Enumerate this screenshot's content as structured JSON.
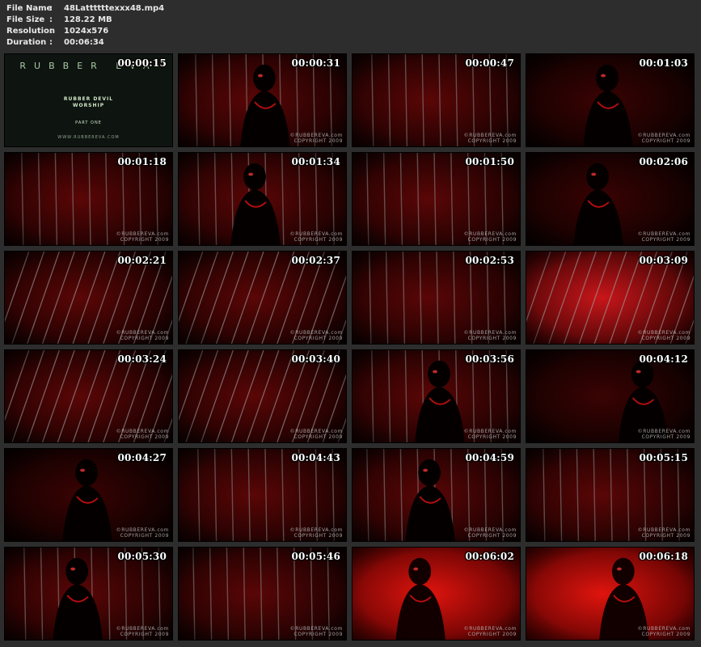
{
  "file_info": {
    "rows": [
      {
        "label": "File Name",
        "value": "48Lattttttexxx48.mp4"
      },
      {
        "label": "File Size",
        "value": "128.22 MB"
      },
      {
        "label": "Resolution",
        "value": "1024x576"
      },
      {
        "label": "Duration",
        "value": "00:06:34"
      }
    ],
    "separator": ":"
  },
  "title_card": {
    "brand": "RUBBER EVA",
    "subtitle_line1": "RUBBER DEVIL",
    "subtitle_line2": "WORSHIP",
    "part": "PART ONE",
    "url": "WWW.RUBBEREVA.COM"
  },
  "watermark": {
    "line1": "©RUBBEREVA.com",
    "line2": "COPYRIGHT 2009"
  },
  "thumbnails": [
    {
      "time": "00:00:15",
      "scene": "title",
      "watermark": false
    },
    {
      "time": "00:00:31",
      "scene": "figure-bars",
      "watermark": true
    },
    {
      "time": "00:00:47",
      "scene": "red-bars",
      "watermark": true
    },
    {
      "time": "00:01:03",
      "scene": "dark-figure",
      "watermark": true
    },
    {
      "time": "00:01:18",
      "scene": "red-bars",
      "watermark": true
    },
    {
      "time": "00:01:34",
      "scene": "figure-bars",
      "watermark": true
    },
    {
      "time": "00:01:50",
      "scene": "red-bars",
      "watermark": true
    },
    {
      "time": "00:02:06",
      "scene": "dark-figure",
      "watermark": true
    },
    {
      "time": "00:02:21",
      "scene": "diag-bars",
      "watermark": true
    },
    {
      "time": "00:02:37",
      "scene": "diag-bars",
      "watermark": true
    },
    {
      "time": "00:02:53",
      "scene": "red-bars",
      "watermark": true
    },
    {
      "time": "00:03:09",
      "scene": "bright-diag",
      "watermark": true
    },
    {
      "time": "00:03:24",
      "scene": "diag-bars",
      "watermark": true
    },
    {
      "time": "00:03:40",
      "scene": "diag-bars",
      "watermark": true
    },
    {
      "time": "00:03:56",
      "scene": "figure-bars",
      "watermark": true
    },
    {
      "time": "00:04:12",
      "scene": "dark-figure",
      "watermark": true
    },
    {
      "time": "00:04:27",
      "scene": "dark-figure",
      "watermark": true
    },
    {
      "time": "00:04:43",
      "scene": "red-bars",
      "watermark": true
    },
    {
      "time": "00:04:59",
      "scene": "figure-bars",
      "watermark": true
    },
    {
      "time": "00:05:15",
      "scene": "red-bars",
      "watermark": true
    },
    {
      "time": "00:05:30",
      "scene": "figure-bars",
      "watermark": true
    },
    {
      "time": "00:05:46",
      "scene": "red-bars",
      "watermark": true
    },
    {
      "time": "00:06:02",
      "scene": "bright-red",
      "watermark": true
    },
    {
      "time": "00:06:18",
      "scene": "bright-red",
      "watermark": true
    }
  ]
}
